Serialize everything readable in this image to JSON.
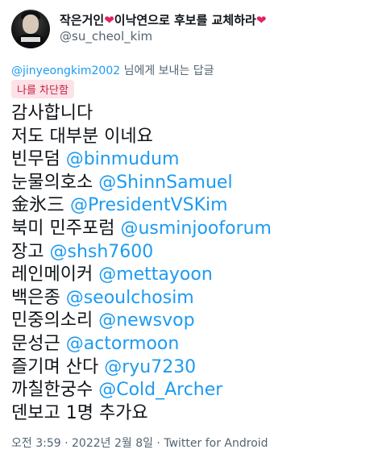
{
  "author": {
    "display_name_parts": [
      "작은거인",
      "이낙연으로 후보를 교체하라"
    ],
    "heart_glyph": "❤",
    "handle": "@su_cheol_kim"
  },
  "reply_context": {
    "mention": "@jinyeongkim2002",
    "suffix": " 님에게 보내는 답글"
  },
  "badge": {
    "label": "나를 차단함"
  },
  "tweet": {
    "lines": [
      {
        "text": "감사합니다",
        "mention": ""
      },
      {
        "text": "저도 대부분 이네요",
        "mention": ""
      },
      {
        "text": "빈무덤 ",
        "mention": "@binmudum"
      },
      {
        "text": "눈물의호소 ",
        "mention": "@ShinnSamuel"
      },
      {
        "text": "金氷三 ",
        "mention": "@PresidentVSKim"
      },
      {
        "text": "북미 민주포럼 ",
        "mention": "@usminjooforum"
      },
      {
        "text": "장고 ",
        "mention": "@shsh7600"
      },
      {
        "text": "레인메이커 ",
        "mention": "@mettayoon"
      },
      {
        "text": "백은종 ",
        "mention": "@seoulchosim"
      },
      {
        "text": "민중의소리 ",
        "mention": "@newsvop"
      },
      {
        "text": "문성근 ",
        "mention": "@actormoon"
      },
      {
        "text": "즐기며 산다 ",
        "mention": "@ryu7230"
      },
      {
        "text": "까칠한궁수 ",
        "mention": "@Cold_Archer"
      },
      {
        "text": "덴보고 1명 추가요",
        "mention": ""
      }
    ]
  },
  "meta": {
    "timestamp": "오전 3:59 · 2022년 2월 8일 · ",
    "source": "Twitter for Android"
  },
  "colors": {
    "link": "#1d9bf0",
    "secondary_text": "#536471",
    "heart": "#e0245e",
    "badge_bg": "#fde2e8",
    "badge_text": "#c0213f"
  }
}
